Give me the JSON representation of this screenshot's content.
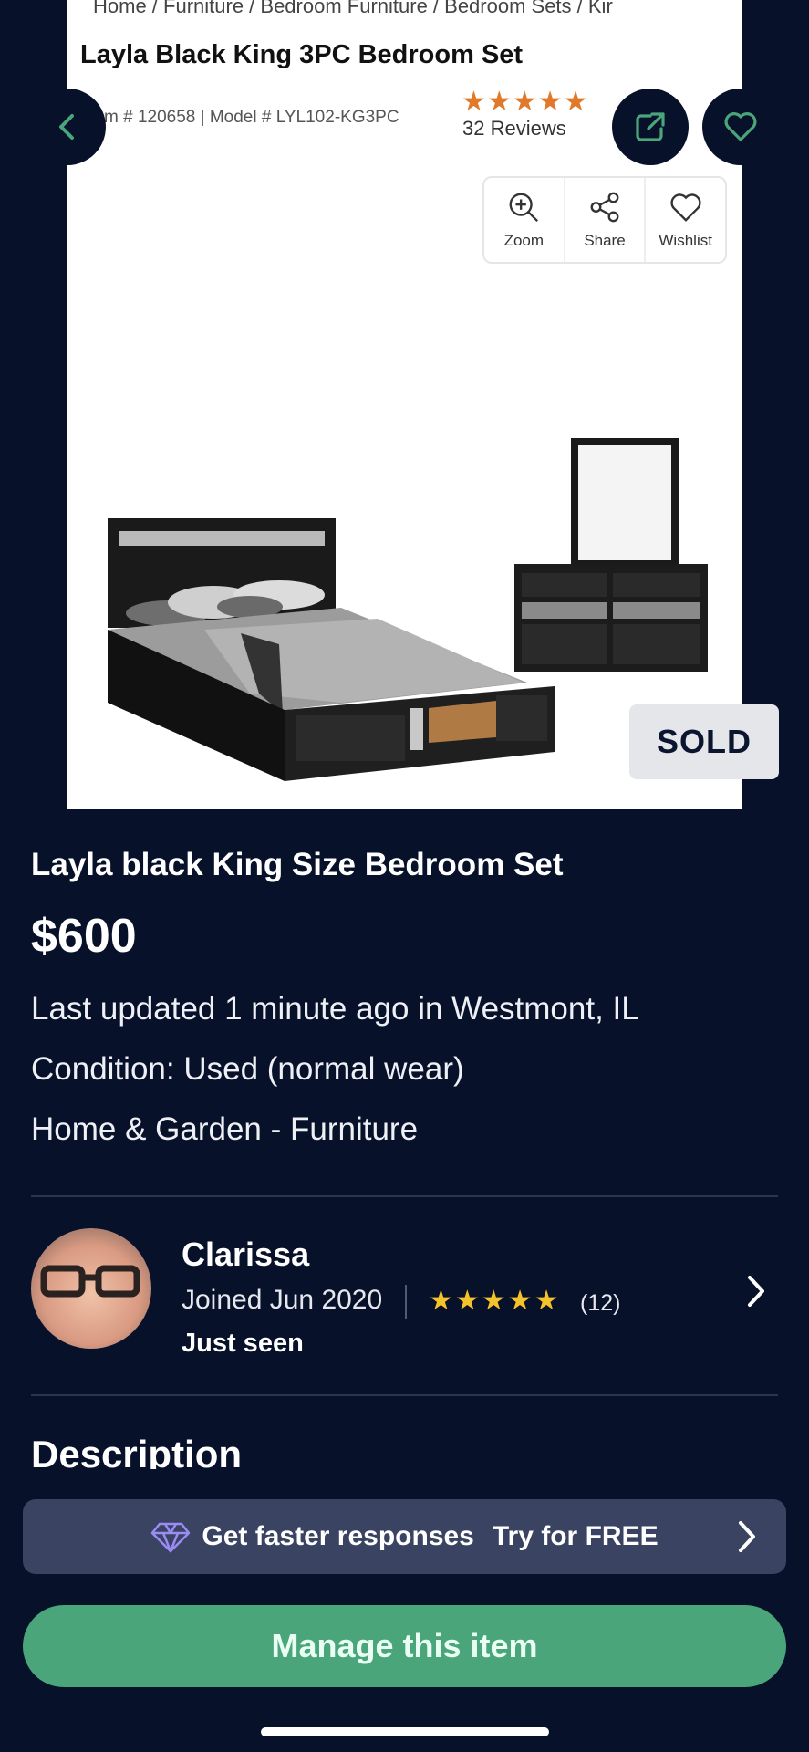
{
  "product_image": {
    "breadcrumb": "Home  /  Furniture  /  Bedroom Furniture  /  Bedroom Sets  /  Kir",
    "title": "Layla Black King 3PC Bedroom Set",
    "meta": "m # 120658 | Model # LYL102-KG3PC",
    "stars": "★★★★★",
    "reviews": "32 Reviews",
    "tools": [
      {
        "label": "Zoom",
        "icon": "zoom-icon"
      },
      {
        "label": "Share",
        "icon": "share-nodes-icon"
      },
      {
        "label": "Wishlist",
        "icon": "heart-outline-icon"
      }
    ]
  },
  "badge": "SOLD",
  "listing": {
    "title": "Layla black King Size Bedroom Set",
    "price": "$600",
    "updated": "Last updated 1 minute ago in Westmont, IL",
    "condition": "Condition: Used (normal wear)",
    "category": "Home & Garden - Furniture"
  },
  "seller": {
    "name": "Clarissa",
    "joined": "Joined Jun 2020",
    "stars": "★★★★★",
    "rating_count": "(12)",
    "last_seen": "Just seen"
  },
  "description_heading": "Description",
  "promo": {
    "text": "Get faster responses",
    "cta": "Try for FREE"
  },
  "manage_button": "Manage this item",
  "colors": {
    "background": "#07112a",
    "accent_green": "#4aa57a",
    "promo_bg": "#3a4361",
    "star": "#f4c22b"
  }
}
